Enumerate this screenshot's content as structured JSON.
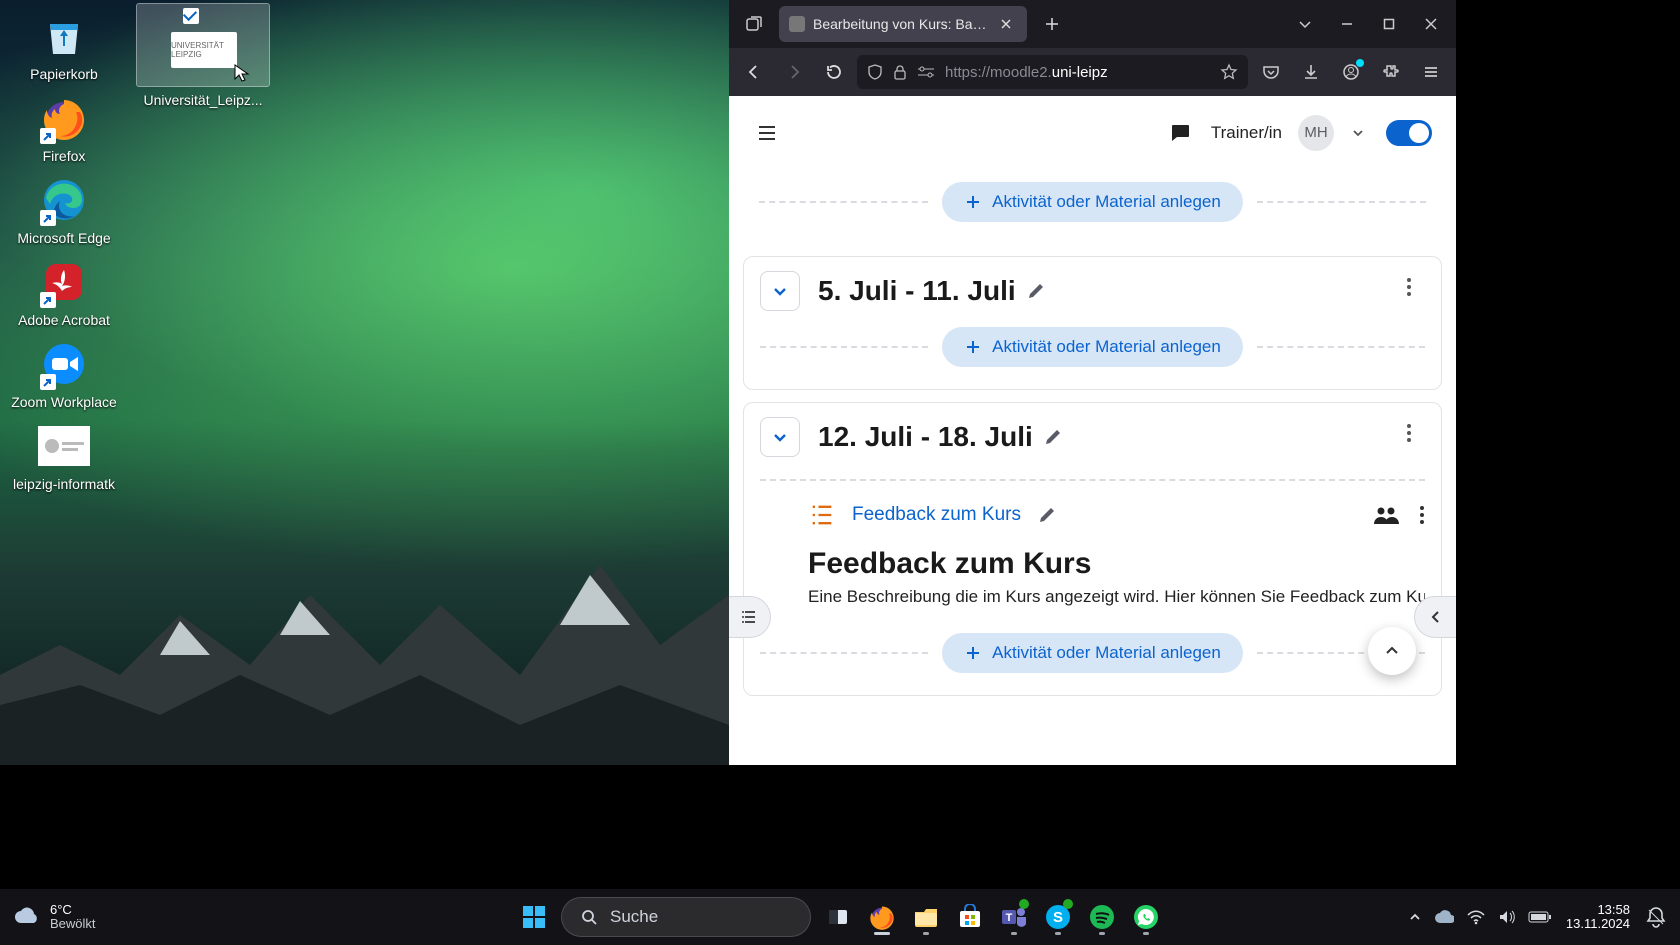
{
  "desktop": {
    "icons": [
      {
        "name": "papierkorb",
        "label": "Papierkorb"
      },
      {
        "name": "firefox",
        "label": "Firefox"
      },
      {
        "name": "edge",
        "label": "Microsoft Edge"
      },
      {
        "name": "acrobat",
        "label": "Adobe Acrobat"
      },
      {
        "name": "zoom",
        "label": "Zoom Workplace"
      },
      {
        "name": "leipzig-informatik",
        "label": "leipzig-informatk"
      }
    ],
    "drag_label": "Universität_Leipz..."
  },
  "browser": {
    "tab_title": "Bearbeitung von Kurs: Bastelku",
    "url_dim1": "https://moodle2.",
    "url_bright": "uni-leipz",
    "url_dim2": ""
  },
  "moodle": {
    "role": "Trainer/in",
    "avatar": "MH",
    "add_label": "Aktivität oder Material anlegen",
    "sections": [
      {
        "title": "5. Juli - 11. Juli"
      },
      {
        "title": "12. Juli - 18. Juli"
      }
    ],
    "activity": {
      "link": "Feedback zum Kurs",
      "heading": "Feedback zum Kurs",
      "desc": "Eine Beschreibung die im Kurs angezeigt wird. Hier können Sie Feedback zum Kurs geb"
    }
  },
  "taskbar": {
    "temp": "6°C",
    "cond": "Bewölkt",
    "search_placeholder": "Suche",
    "time": "13:58",
    "date": "13.11.2024"
  }
}
